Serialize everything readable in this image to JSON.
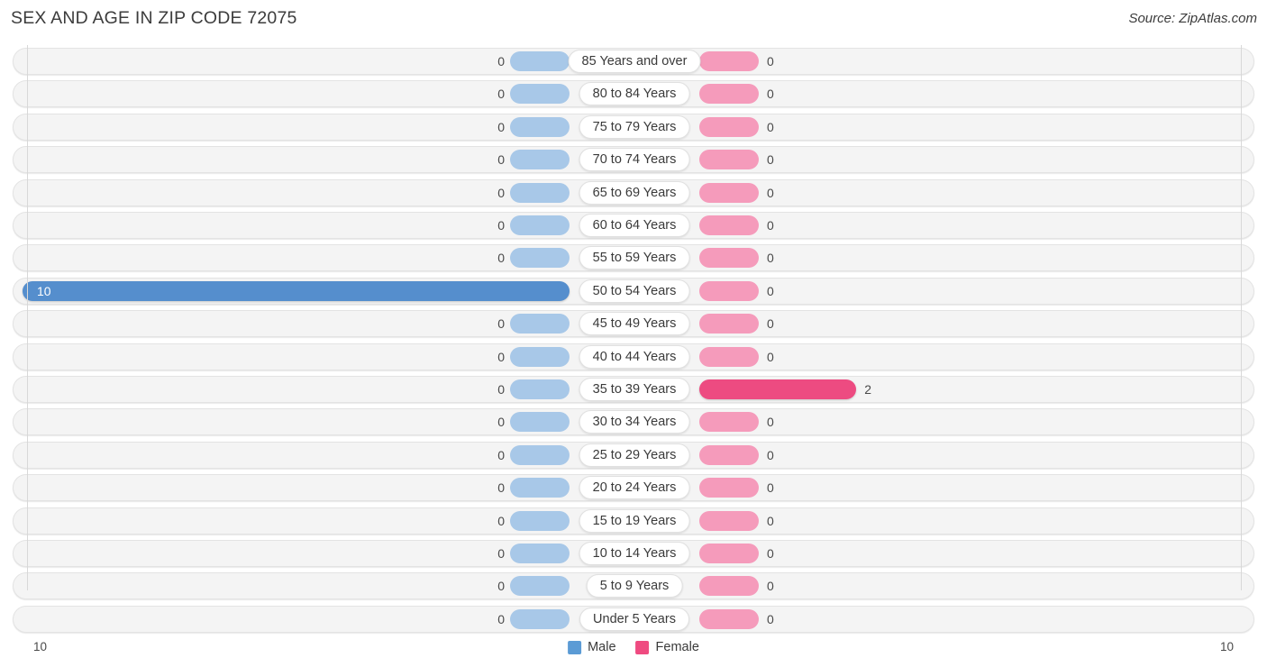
{
  "header": {
    "title": "SEX AND AGE IN ZIP CODE 72075",
    "source": "Source: ZipAtlas.com"
  },
  "legend": {
    "items": [
      {
        "label": "Male",
        "color": "#5b9bd5"
      },
      {
        "label": "Female",
        "color": "#ef4a80"
      }
    ]
  },
  "axis": {
    "left_label": "10",
    "right_label": "10"
  },
  "chart_data": {
    "type": "bar",
    "title": "SEX AND AGE IN ZIP CODE 72075",
    "subtitle": "Source: ZipAtlas.com",
    "orientation": "horizontal",
    "style": "population-pyramid",
    "xlabel": "",
    "ylabel": "",
    "xlim": [
      10,
      10
    ],
    "grid": true,
    "legend_position": "bottom-center",
    "categories": [
      "85 Years and over",
      "80 to 84 Years",
      "75 to 79 Years",
      "70 to 74 Years",
      "65 to 69 Years",
      "60 to 64 Years",
      "55 to 59 Years",
      "50 to 54 Years",
      "45 to 49 Years",
      "40 to 44 Years",
      "35 to 39 Years",
      "30 to 34 Years",
      "25 to 29 Years",
      "20 to 24 Years",
      "15 to 19 Years",
      "10 to 14 Years",
      "5 to 9 Years",
      "Under 5 Years"
    ],
    "series": [
      {
        "name": "Male",
        "color": "#a8c8e8",
        "highlight_color": "#558ecd",
        "values": [
          0,
          0,
          0,
          0,
          0,
          0,
          0,
          10,
          0,
          0,
          0,
          0,
          0,
          0,
          0,
          0,
          0,
          0
        ]
      },
      {
        "name": "Female",
        "color": "#f59bbb",
        "highlight_color": "#ed4b81",
        "values": [
          0,
          0,
          0,
          0,
          0,
          0,
          0,
          0,
          0,
          0,
          2,
          0,
          0,
          0,
          0,
          0,
          0,
          0
        ]
      }
    ]
  },
  "rows": [
    {
      "label": "85 Years and over",
      "male": "0",
      "female": "0"
    },
    {
      "label": "80 to 84 Years",
      "male": "0",
      "female": "0"
    },
    {
      "label": "75 to 79 Years",
      "male": "0",
      "female": "0"
    },
    {
      "label": "70 to 74 Years",
      "male": "0",
      "female": "0"
    },
    {
      "label": "65 to 69 Years",
      "male": "0",
      "female": "0"
    },
    {
      "label": "60 to 64 Years",
      "male": "0",
      "female": "0"
    },
    {
      "label": "55 to 59 Years",
      "male": "0",
      "female": "0"
    },
    {
      "label": "50 to 54 Years",
      "male": "10",
      "female": "0"
    },
    {
      "label": "45 to 49 Years",
      "male": "0",
      "female": "0"
    },
    {
      "label": "40 to 44 Years",
      "male": "0",
      "female": "0"
    },
    {
      "label": "35 to 39 Years",
      "male": "0",
      "female": "2"
    },
    {
      "label": "30 to 34 Years",
      "male": "0",
      "female": "0"
    },
    {
      "label": "25 to 29 Years",
      "male": "0",
      "female": "0"
    },
    {
      "label": "20 to 24 Years",
      "male": "0",
      "female": "0"
    },
    {
      "label": "15 to 19 Years",
      "male": "0",
      "female": "0"
    },
    {
      "label": "10 to 14 Years",
      "male": "0",
      "female": "0"
    },
    {
      "label": "5 to 9 Years",
      "male": "0",
      "female": "0"
    },
    {
      "label": "Under 5 Years",
      "male": "0",
      "female": "0"
    }
  ]
}
